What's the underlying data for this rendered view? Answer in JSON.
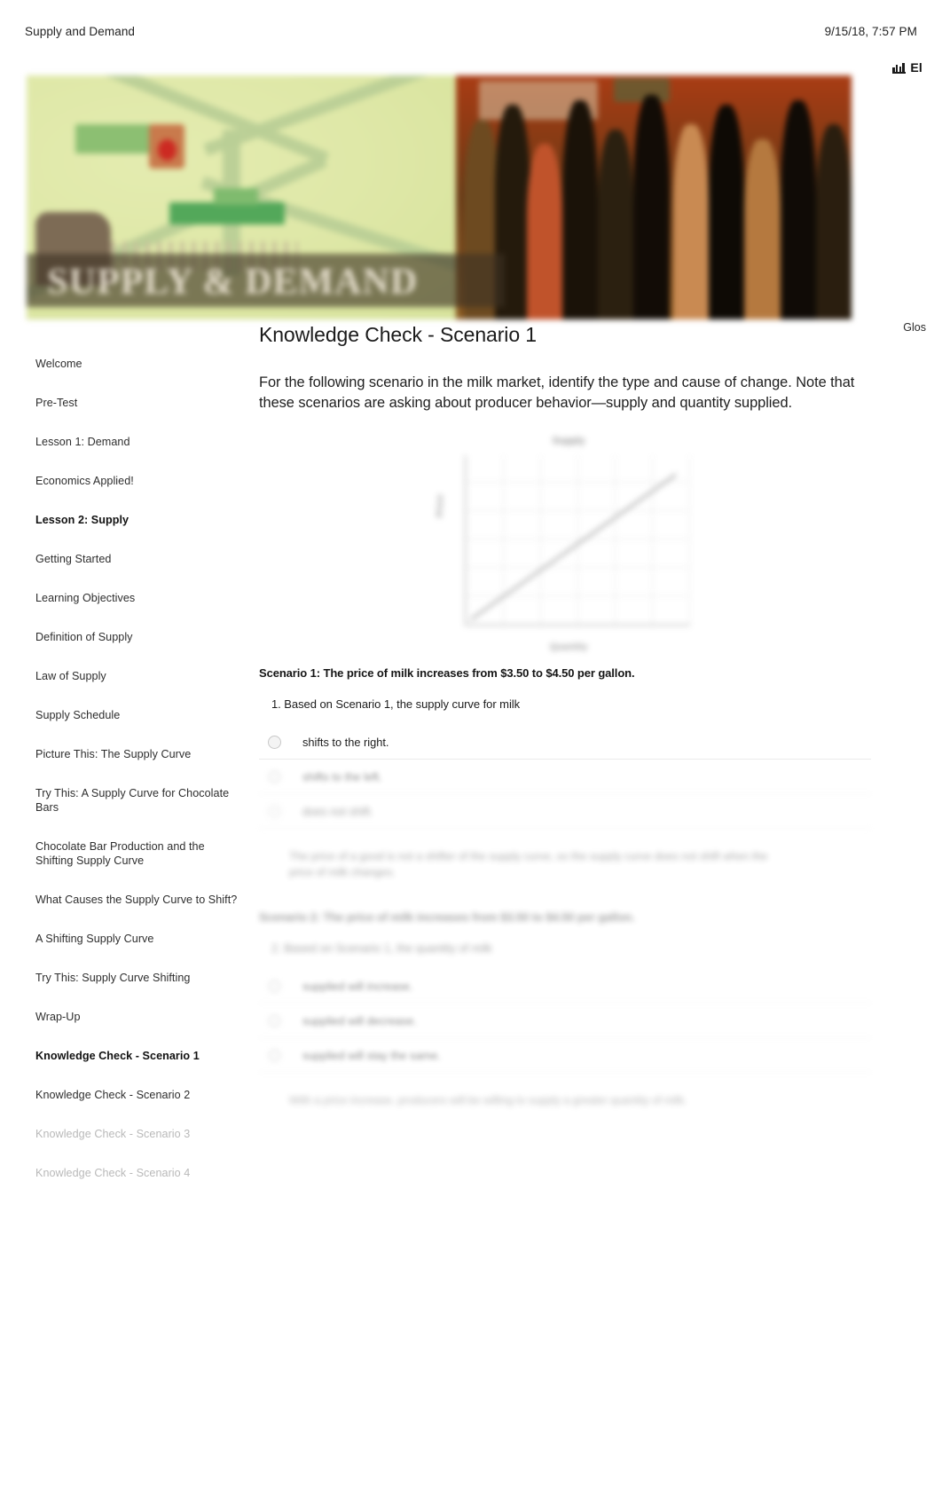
{
  "print_header": {
    "doc_title": "Supply and Demand",
    "date": "9/15/18, 7:57 PM"
  },
  "top_badge": {
    "icon": "bar-chart-icon",
    "label": "El"
  },
  "banner": {
    "title": "SUPPLY & DEMAND"
  },
  "glossary": {
    "label": "Glos"
  },
  "sidebar": {
    "items": [
      {
        "label": "Welcome",
        "state": "normal"
      },
      {
        "label": "Pre-Test",
        "state": "normal"
      },
      {
        "label": "Lesson 1: Demand",
        "state": "normal"
      },
      {
        "label": "Economics Applied!",
        "state": "normal"
      },
      {
        "label": "Lesson 2: Supply",
        "state": "current"
      },
      {
        "label": "Getting Started",
        "state": "normal"
      },
      {
        "label": "Learning Objectives",
        "state": "normal"
      },
      {
        "label": "Definition of Supply",
        "state": "normal"
      },
      {
        "label": "Law of Supply",
        "state": "normal"
      },
      {
        "label": "Supply Schedule",
        "state": "normal"
      },
      {
        "label": "Picture This: The Supply Curve",
        "state": "normal"
      },
      {
        "label": "Try This: A Supply Curve for Chocolate Bars",
        "state": "normal"
      },
      {
        "label": "Chocolate Bar Production and the Shifting Supply Curve",
        "state": "normal"
      },
      {
        "label": "What Causes the Supply Curve to Shift?",
        "state": "normal"
      },
      {
        "label": "A Shifting Supply Curve",
        "state": "normal"
      },
      {
        "label": "Try This: Supply Curve Shifting",
        "state": "normal"
      },
      {
        "label": "Wrap-Up",
        "state": "normal"
      },
      {
        "label": "Knowledge Check - Scenario 1",
        "state": "current"
      },
      {
        "label": "Knowledge Check - Scenario 2",
        "state": "normal"
      },
      {
        "label": "Knowledge Check - Scenario 3",
        "state": "dim"
      },
      {
        "label": "Knowledge Check - Scenario 4",
        "state": "dim"
      }
    ]
  },
  "main": {
    "title": "Knowledge Check - Scenario 1",
    "intro": "For the following scenario in the milk market, identify the type and cause of change. Note that these scenarios are asking about producer behavior—supply and quantity supplied.",
    "scenario_1": {
      "statement": "Scenario 1: The price of milk increases from $3.50 to $4.50 per gallon.",
      "question": "1. Based on Scenario 1, the supply curve for milk",
      "options": [
        {
          "label": "shifts to the right.",
          "blur": "none"
        },
        {
          "label": "shifts to the left.",
          "blur": "medium"
        },
        {
          "label": "does not shift.",
          "blur": "heavy"
        }
      ],
      "feedback": "The price of a good is not a shifter of the supply curve, so the supply curve does not shift when the price of milk changes."
    },
    "scenario_2": {
      "statement": "Scenario 2: The price of milk increases from $3.50 to $4.50 per gallon.",
      "question": "2. Based on Scenario 1, the quantity of milk",
      "options": [
        {
          "label": "supplied will increase.",
          "blur": "medium"
        },
        {
          "label": "supplied will decrease.",
          "blur": "medium"
        },
        {
          "label": "supplied will stay the same.",
          "blur": "medium"
        }
      ],
      "feedback": "With a price increase, producers will be willing to supply a greater quantity of milk."
    }
  },
  "chart_data": {
    "type": "line",
    "title": "Supply",
    "xlabel": "Quantity",
    "ylabel": "Price",
    "x": [
      0,
      1,
      2,
      3,
      4,
      5
    ],
    "series": [
      {
        "name": "Supply",
        "values": [
          0,
          1,
          2,
          3,
          4,
          5
        ]
      }
    ],
    "xlim": [
      0,
      5
    ],
    "ylim": [
      0,
      5
    ],
    "grid": true,
    "legend": "none",
    "ytick_labels": [
      "",
      "",
      "",
      "",
      "",
      ""
    ],
    "xtick_labels": [
      "",
      "",
      "",
      "",
      "",
      ""
    ]
  }
}
